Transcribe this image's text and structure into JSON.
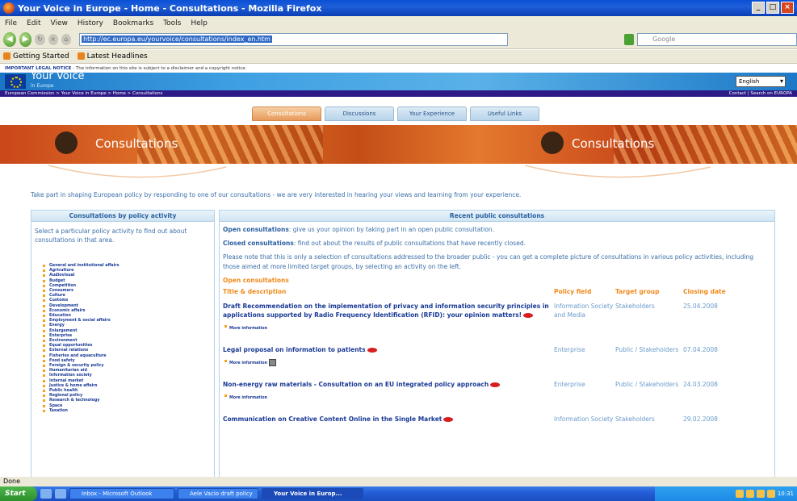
{
  "window": {
    "title": "Your Voice in Europe - Home - Consultations - Mozilla Firefox"
  },
  "menu": [
    "File",
    "Edit",
    "View",
    "History",
    "Bookmarks",
    "Tools",
    "Help"
  ],
  "navbar": {
    "url": "http://ec.europa.eu/yourvoice/consultations/index_en.htm",
    "search_placeholder": "Google"
  },
  "bookmarks": [
    "Getting Started",
    "Latest Headlines"
  ],
  "legal_notice": {
    "label": "IMPORTANT LEGAL NOTICE",
    "text": "- The information on this site is subject to a disclaimer and a copyright notice."
  },
  "site": {
    "brand": "Your Voice",
    "brand_sub": "in Europe",
    "language": "English"
  },
  "breadcrumb": {
    "path": "European Commission > Your Voice in Europe > Home > Consultations",
    "right": "Contact | Search on EUROPA"
  },
  "tabs": [
    "Consultations",
    "Discussions",
    "Your Experience",
    "Useful Links"
  ],
  "banner": {
    "title": "Consultations"
  },
  "intro": "Take part in shaping European policy by responding to one of our consultations - we are very interested in hearing your views and learning from your experience.",
  "left": {
    "heading": "Consultations by policy activity",
    "desc": "Select a particular policy activity to find out about consultations in that area.",
    "activities": [
      "General and institutional affairs",
      "Agriculture",
      "Audiovisual",
      "Budget",
      "Competition",
      "Consumers",
      "Culture",
      "Customs",
      "Development",
      "Economic affairs",
      "Education",
      "Employment & social affairs",
      "Energy",
      "Enlargement",
      "Enterprise",
      "Environment",
      "Equal opportunities",
      "External relations",
      "Fisheries and aquaculture",
      "Food safety",
      "Foreign & security policy",
      "Humanitarian aid",
      "Information society",
      "Internal market",
      "Justice & home affairs",
      "Public health",
      "Regional policy",
      "Research & technology",
      "Space",
      "Taxation"
    ]
  },
  "right": {
    "heading": "Recent public consultations",
    "open_label": "Open consultations",
    "open_text": ": give us your opinion by taking part in an open public consultation.",
    "closed_label": "Closed consultations",
    "closed_text": ": find out about the results of public consultations that have recently closed.",
    "note": "Please note that this is only a selection of consultations addressed to the broader public - you can get a complete picture of consultations in various policy activities, including those aimed at more limited target groups, by selecting an activity on the left.",
    "section_title": "Open consultations",
    "columns": [
      "Title & description",
      "Policy field",
      "Target group",
      "Closing date"
    ],
    "more_info": "More information",
    "rows": [
      {
        "title": "Draft Recommendation on the implementation of privacy and information security principles in applications supported by Radio Frequency Identification (RFID): your opinion matters!",
        "field": "Information Society and Media",
        "target": "Stakeholders",
        "date": "25.04.2008"
      },
      {
        "title": "Legal proposal on information to patients",
        "field": "Enterprise",
        "target": "Public / Stakeholders",
        "date": "07.04.2008"
      },
      {
        "title": "Non-energy raw materials - Consultation on an EU integrated policy approach",
        "field": "Enterprise",
        "target": "Public / Stakeholders",
        "date": "24.03.2008"
      },
      {
        "title": "Communication on Creative Content Online in the Single Market",
        "field": "Information Society",
        "target": "Stakeholders",
        "date": "29.02.2008"
      }
    ]
  },
  "status": "Done",
  "taskbar": {
    "start": "Start",
    "tasks": [
      "Inbox - Microsoft Outlook",
      "Aele Vacio draft policy at",
      "Your Voice in Europ..."
    ],
    "clock": "10:31"
  }
}
